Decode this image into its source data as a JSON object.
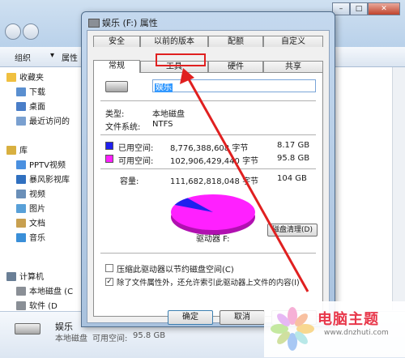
{
  "explorer": {
    "toolbar": {
      "organize": "组织",
      "properties": "属性"
    },
    "nav": [
      {
        "label": "收藏夹",
        "kind": "header"
      },
      {
        "label": "下载"
      },
      {
        "label": "桌面"
      },
      {
        "label": "最近访问的"
      },
      {
        "label": "库",
        "kind": "header"
      },
      {
        "label": "PPTV视频"
      },
      {
        "label": "暴风影视库"
      },
      {
        "label": "视频"
      },
      {
        "label": "图片"
      },
      {
        "label": "文档"
      },
      {
        "label": "音乐"
      },
      {
        "label": "计算机",
        "kind": "header"
      },
      {
        "label": "本地磁盘 (C"
      },
      {
        "label": "软件 (D"
      }
    ],
    "details": {
      "name": "娱乐",
      "type": "本地磁盘",
      "free_label": "可用空间:",
      "free_value": "95.8 GB"
    }
  },
  "dialog": {
    "title": "娱乐 (F:) 属性",
    "tabs_back": [
      "安全",
      "以前的版本",
      "配额",
      "自定义"
    ],
    "tabs_front": [
      "常规",
      "工具",
      "硬件",
      "共享"
    ],
    "general": {
      "volume_name": "娱乐",
      "type_label": "类型:",
      "type_value": "本地磁盘",
      "fs_label": "文件系统:",
      "fs_value": "NTFS",
      "used_label": "已用空间:",
      "used_bytes": "8,776,388,608 字节",
      "used_size": "8.17 GB",
      "free_label": "可用空间:",
      "free_bytes": "102,906,429,440 字节",
      "free_size": "95.8 GB",
      "capacity_label": "容量:",
      "capacity_bytes": "111,682,818,048 字节",
      "capacity_size": "104 GB",
      "drive_label": "驱动器 F:",
      "disk_cleanup": "磁盘清理(D)",
      "compress_label": "压缩此驱动器以节约磁盘空间(C)",
      "index_label": "除了文件属性外，还允许索引此驱动器上文件的内容(I)",
      "used_fraction": 0.0786
    },
    "buttons": {
      "ok": "确定",
      "cancel": "取消"
    }
  },
  "watermark": {
    "title": "电脑主题",
    "url": "www.dnzhuti.com"
  },
  "colors": {
    "used": "#2020ee",
    "free": "#ff20ff",
    "highlight": "#e02020"
  }
}
